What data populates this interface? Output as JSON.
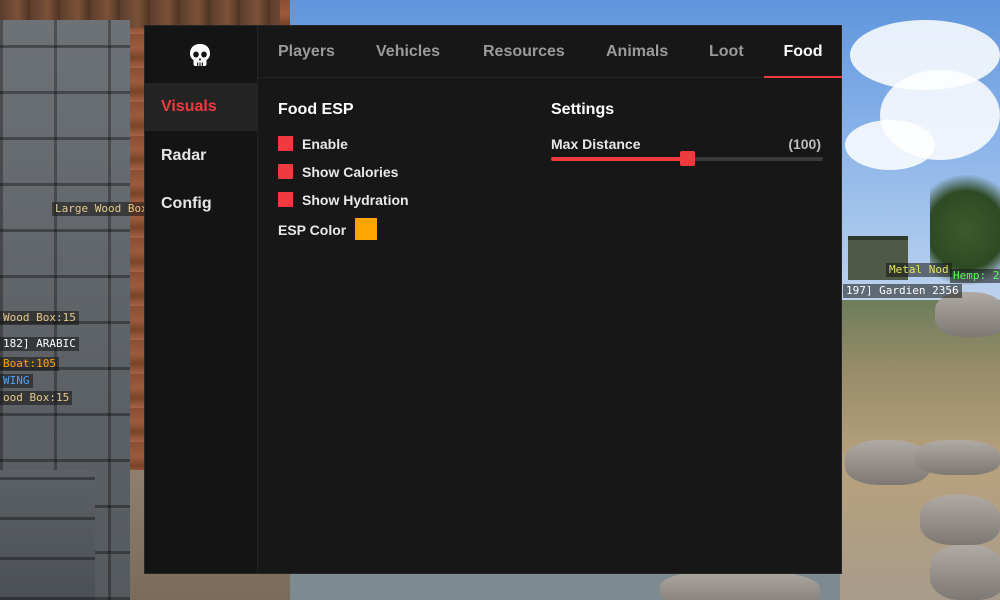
{
  "menu": {
    "logo_icon": "skull-icon",
    "accent_color": "#ef3a3f",
    "sidebar": {
      "items": [
        {
          "label": "Visuals",
          "active": true
        },
        {
          "label": "Radar",
          "active": false
        },
        {
          "label": "Config",
          "active": false
        }
      ]
    },
    "tabs": [
      {
        "label": "Players",
        "active": false
      },
      {
        "label": "Vehicles",
        "active": false
      },
      {
        "label": "Resources",
        "active": false
      },
      {
        "label": "Animals",
        "active": false
      },
      {
        "label": "Loot",
        "active": false
      },
      {
        "label": "Food",
        "active": true
      }
    ],
    "food_esp": {
      "title": "Food ESP",
      "options": [
        {
          "label": "Enable",
          "checked": true
        },
        {
          "label": "Show Calories",
          "checked": true
        },
        {
          "label": "Show Hydration",
          "checked": true
        }
      ],
      "esp_color_label": "ESP Color",
      "esp_color": "#ffa500"
    },
    "settings": {
      "title": "Settings",
      "max_distance_label": "Max Distance",
      "max_distance_value": "(100)",
      "max_distance_fraction": 0.5
    }
  },
  "game_overlay": {
    "labels": [
      {
        "text": "Large Wood Box",
        "color": "#e6c98a"
      },
      {
        "text": "Wood Box:15",
        "color": "#e6c98a"
      },
      {
        "text": "182] ARABIC",
        "color": "#ffffff"
      },
      {
        "text": "Boat:105",
        "color": "#ffa500"
      },
      {
        "text": "WING",
        "color": "#4aa3ff"
      },
      {
        "text": "ood Box:15",
        "color": "#e6c98a"
      },
      {
        "text": "Metal Nod",
        "color": "#e6e65a"
      },
      {
        "text": "Hemp: 2",
        "color": "#5aff5a"
      },
      {
        "text": "197] Gardien 2356",
        "color": "#ffffff"
      }
    ]
  }
}
